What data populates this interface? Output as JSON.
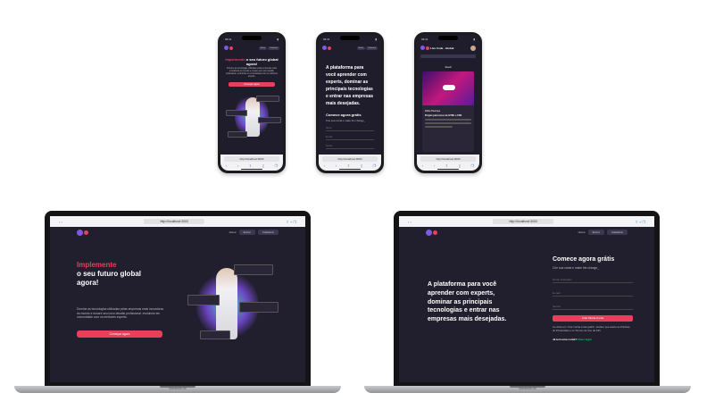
{
  "status_time": "09:41",
  "phone1": {
    "title_accent": "Implemente",
    "title_rest": " o seu futuro global agora!",
    "description": "Domine as tecnologias utilizadas pelas empresas mais inovadoras do mundo e encare seu novo desafio profissional, evoluindo em comunidade com os melhores experts.",
    "cta": "Começar agora",
    "nav_btn1": "Entrar",
    "nav_btn2": "Cadastrar",
    "url": "http://localhost:3000"
  },
  "phone2": {
    "headline": "A plataforma para você aprender com experts, dominar as principais tecnologias e entrar nas empresas mais desejadas.",
    "title": "Comece agora grátis",
    "subtitle": "Crie sua conta e make the change_",
    "field_name": "Nome",
    "field_email": "E-mail",
    "field_password": "Senha",
    "url": "http://localhost:3000"
  },
  "phone3": {
    "app_title": "Live Code · Global",
    "feed_label": "Feed",
    "author": "Pablo Henrique",
    "post_title": "Projeto para curso de HTML e CSS",
    "url": "http://localhost:3000"
  },
  "laptop1": {
    "url": "http://localhost:3000",
    "nav_home": "Home",
    "nav_login": "Entrar",
    "nav_signup": "Cadastrar",
    "title_accent": "Implemente",
    "title_rest": "o seu futuro global agora!",
    "description": "Domine as tecnologias utilizadas pelas empresas mais inovadoras do mundo e encare seu novo desafio profissional, evoluindo em comunidade com os melhores experts.",
    "cta": "Começar agora",
    "brand_label": "MacBook Air"
  },
  "laptop2": {
    "url": "http://localhost:3000",
    "nav_home": "Home",
    "nav_login": "Entrar",
    "nav_signup": "Cadastrar",
    "headline": "A plataforma para você aprender com experts, dominar as principais tecnologias e entrar nas empresas mais desejadas.",
    "title": "Comece agora grátis",
    "subtitle": "Crie sua conta e make the change_",
    "field_name": "Nome Completo",
    "field_email": "E-mail",
    "field_password": "Senha",
    "submit": "Criar Minha Conta",
    "terms": "Ao clicar em \"criar minha conta grátis\", declaro que aceito as Políticas de Privacidade e os Termos de Uso da DIO.",
    "login_question": "Já tem uma conta?",
    "login_link": "Fazer login",
    "brand_label": "MacBook Air"
  },
  "colors": {
    "accent": "#e83f5b",
    "purple": "#8257e6",
    "bg": "#211e2e",
    "green": "#04d361"
  }
}
